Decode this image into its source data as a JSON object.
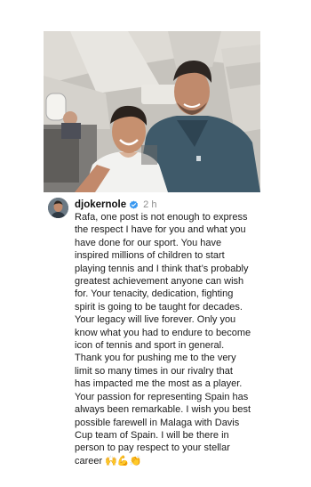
{
  "post": {
    "username": "djokernole",
    "time": "2 h",
    "caption": "Rafa, one post is not enough to express\nthe respect I have for you and what you\nhave done for our sport. You have\ninspired millions of children to start\nplaying tennis and I think that’s probably\ngreatest achievement anyone can wish\nfor. Your tenacity, dedication, fighting\nspirit is going to be taught for decades.\nYour legacy will live forever. Only you\nknow what you had to endure to become\nicon of tennis and sport in general.\nThank you for pushing me to the very\nlimit so many times in our rivalry that\nhas impacted me the most as a player.\nYour passion for representing Spain has\nalways been remarkable. I wish you best\npossible farewell in Malaga with Davis\nCup team of Spain. I will be there in\nperson to pay respect to your stellar\ncareer 🙌💪👏"
  },
  "icons": {
    "verified": "verified-badge-icon",
    "avatar": "profile-avatar"
  },
  "colors": {
    "verified_blue": "#3797f0",
    "time_gray": "#8e8e8e"
  }
}
